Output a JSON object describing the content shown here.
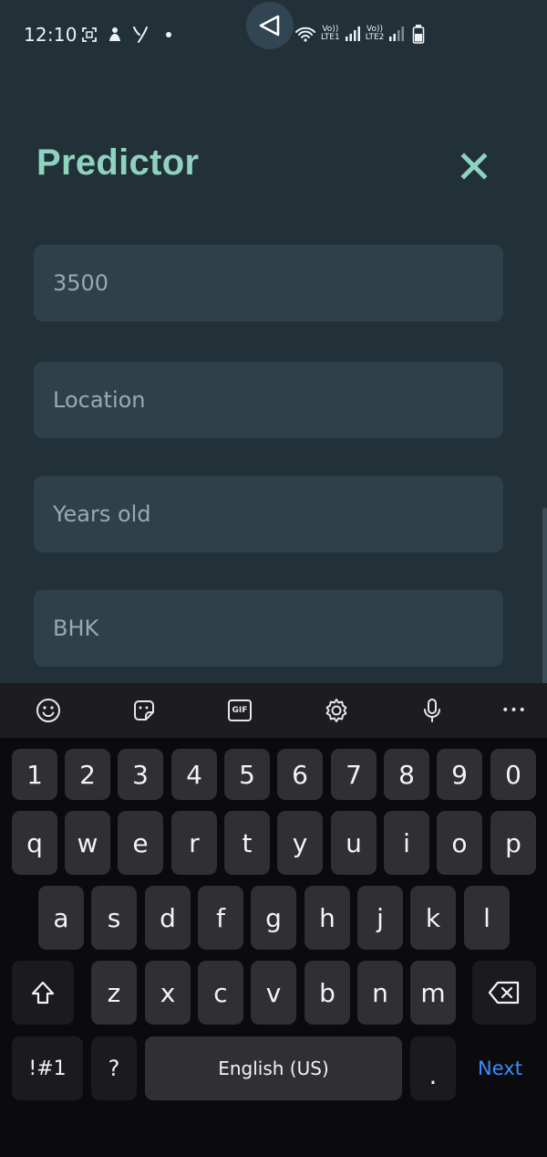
{
  "status_bar": {
    "time": "12:10",
    "sim1_label": "Vo))",
    "sim1_net": "LTE1",
    "sim2_label": "Vo))",
    "sim2_net": "LTE2"
  },
  "header": {
    "title": "Predictor",
    "close_icon": "close-icon"
  },
  "form": {
    "area_value": "3500",
    "location_placeholder": "Location",
    "years_placeholder": "Years old",
    "bhk_placeholder": "BHK"
  },
  "keyboard": {
    "toolbar": [
      "emoji-icon",
      "sticker-icon",
      "gif-icon",
      "settings-icon",
      "mic-icon",
      "more-icon"
    ],
    "gif_label": "GIF",
    "more_label": "•••",
    "rows": [
      [
        "1",
        "2",
        "3",
        "4",
        "5",
        "6",
        "7",
        "8",
        "9",
        "0"
      ],
      [
        "q",
        "w",
        "e",
        "r",
        "t",
        "y",
        "u",
        "i",
        "o",
        "p"
      ],
      [
        "a",
        "s",
        "d",
        "f",
        "g",
        "h",
        "j",
        "k",
        "l"
      ],
      [
        "z",
        "x",
        "c",
        "v",
        "b",
        "n",
        "m"
      ]
    ],
    "symbols_label": "!#1",
    "question_label": "?",
    "space_label": "English (US)",
    "period_label": ".",
    "next_label": "Next"
  },
  "colors": {
    "background": "#223038",
    "accent": "#8fd3bf",
    "field": "#2e414b",
    "next": "#3b8cff"
  }
}
